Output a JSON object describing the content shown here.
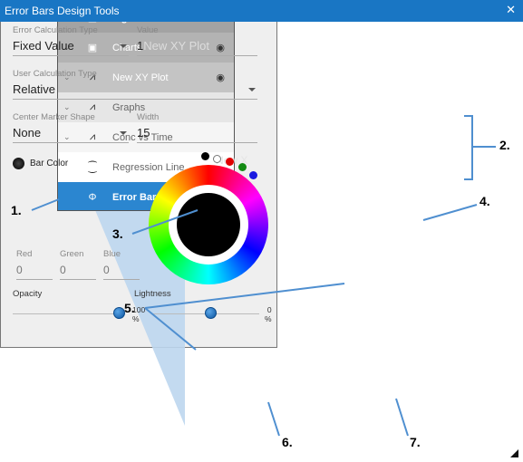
{
  "sidebar": {
    "items": [
      {
        "label": "Figure",
        "icon": "layout-icon",
        "bg": "#a3a3a3",
        "chevron": false,
        "eye": false
      },
      {
        "label": "Charts",
        "icon": "charts-icon",
        "bg": "#b3b3b3",
        "chevron": true,
        "eye": true
      },
      {
        "label": "New XY Plot",
        "icon": "xy-plot-icon",
        "bg": "#c4c4c4",
        "chevron": true,
        "eye": true
      },
      {
        "label": "Graphs",
        "icon": "graph-icon",
        "bg": "#e6e6e6",
        "chevron": true,
        "eye": false
      },
      {
        "label": "Conc vs Time",
        "icon": "graph-icon",
        "bg": "#f5f5f5",
        "chevron": true,
        "eye": false
      },
      {
        "label": "Regression Line",
        "icon": "regression-icon",
        "bg": "#ffffff",
        "chevron": false,
        "eye": false
      },
      {
        "label": "Error Bars",
        "icon": "error-bars-icon",
        "bg": "#2b86d0",
        "chevron": false,
        "eye": false
      }
    ]
  },
  "dialog": {
    "title": "Error Bars Design Tools",
    "error_calc_label": "Error Calculation Type",
    "error_calc_value": "Fixed Value",
    "value_label": "Value",
    "value_value": "1",
    "value_ghost": "New XY Plot",
    "user_calc_label": "User Calculation Type",
    "user_calc_value": "Relative",
    "marker_label": "Center Marker Shape",
    "marker_value": "None",
    "width_label": "Width",
    "width_value": "15",
    "bar_color_label": "Bar Color",
    "bar_color": "#000000",
    "swatch_ghost": "New X",
    "swatches": [
      "#000000",
      "#ffffff",
      "#e00000",
      "#138a13",
      "#1a1ae0"
    ],
    "red_label": "Red",
    "red_value": "0",
    "green_label": "Green",
    "green_value": "0",
    "blue_label": "Blue",
    "blue_value": "0",
    "opacity_label": "Opacity",
    "opacity_value_text": "100\n%",
    "opacity_percent": 100,
    "lightness_label": "Lightness",
    "lightness_value_text": "0\n%",
    "lightness_percent": 0
  },
  "callouts": [
    "1.",
    "2.",
    "3.",
    "4.",
    "5.",
    "6.",
    "7."
  ],
  "accent": "#1976c4"
}
